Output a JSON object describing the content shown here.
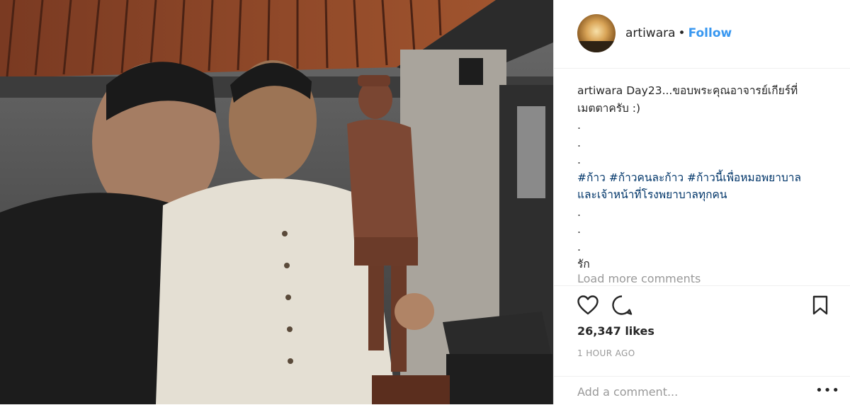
{
  "header": {
    "username": "artiwara",
    "separator": "•",
    "follow_label": "Follow"
  },
  "caption": {
    "username": "artiwara",
    "line1": "Day23...ขอบพระคุณอาจารย์เกียร์ที่",
    "line2": "เมตตาครับ :)",
    "dot1": ".",
    "dot2": ".",
    "dot3": ".",
    "hashtag1": "#ก้าว",
    "hashtag2": "#ก้าวคนละก้าว",
    "hashtag3": "#ก้าวนี้เพื่อหมอพยาบาล",
    "hashtag3_cont": "และเจ้าหน้าที่โรงพยาบาลทุกคน",
    "dot4": ".",
    "dot5": ".",
    "dot6": ".",
    "closing": "รัก"
  },
  "load_more": "Load more comments",
  "actions": {
    "like_icon": "heart-icon",
    "comment_icon": "comment-icon",
    "save_icon": "bookmark-icon"
  },
  "likes": "26,347 likes",
  "timestamp": "1 HOUR AGO",
  "comment_box": {
    "placeholder": "Add a comment...",
    "more_label": "•••"
  },
  "colors": {
    "follow": "#3897f0",
    "hashtag": "#003569",
    "muted": "#999999"
  }
}
